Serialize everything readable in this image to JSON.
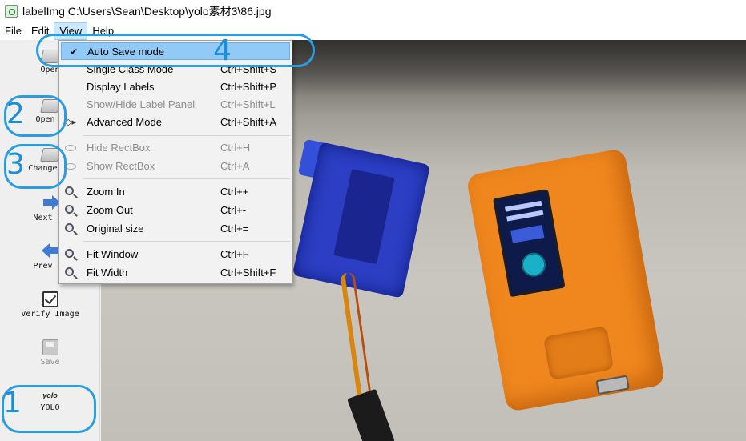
{
  "window": {
    "title": "labelImg C:\\Users\\Sean\\Desktop\\yolo素材3\\86.jpg",
    "icon": "labelimg-app-icon"
  },
  "menubar": {
    "items": [
      {
        "label": "File"
      },
      {
        "label": "Edit"
      },
      {
        "label": "View"
      },
      {
        "label": "Help"
      }
    ]
  },
  "toolbar": {
    "items": [
      {
        "label": "Open",
        "icon": "folder-icon"
      },
      {
        "label": "Open D",
        "icon": "folder-icon"
      },
      {
        "label": "Change Sa",
        "icon": "folder-icon"
      },
      {
        "label": "Next Im",
        "icon": "arrow-right-icon"
      },
      {
        "label": "Prev Im",
        "icon": "arrow-left-icon"
      },
      {
        "label": "Verify Image",
        "icon": "check-box-icon"
      },
      {
        "label": "Save",
        "icon": "save-icon",
        "disabled": true
      },
      {
        "label": "YOLO",
        "icon": "yolo-icon",
        "icon_text": "yolo"
      }
    ]
  },
  "view_menu": {
    "items": [
      {
        "label": "Auto Save mode",
        "shortcut": "",
        "checked": true,
        "highlighted": true
      },
      {
        "label": "Single Class Mode",
        "shortcut": "Ctrl+Shift+S"
      },
      {
        "label": "Display Labels",
        "shortcut": "Ctrl+Shift+P"
      },
      {
        "label": "Show/Hide Label Panel",
        "shortcut": "Ctrl+Shift+L",
        "disabled": true
      },
      {
        "label": "Advanced Mode",
        "shortcut": "Ctrl+Shift+A",
        "icon": "advanced-mode-icon"
      },
      {
        "label": "Hide RectBox",
        "shortcut": "Ctrl+H",
        "disabled": true,
        "icon": "eye-icon"
      },
      {
        "label": "Show RectBox",
        "shortcut": "Ctrl+A",
        "disabled": true,
        "icon": "eye-icon"
      },
      {
        "label": "Zoom In",
        "shortcut": "Ctrl++",
        "icon": "zoom-in-icon"
      },
      {
        "label": "Zoom Out",
        "shortcut": "Ctrl+-",
        "icon": "zoom-out-icon"
      },
      {
        "label": "Original size",
        "shortcut": "Ctrl+=",
        "icon": "zoom-original-icon"
      },
      {
        "label": "Fit Window",
        "shortcut": "Ctrl+F",
        "icon": "fit-window-icon"
      },
      {
        "label": "Fit Width",
        "shortcut": "Ctrl+Shift+F",
        "icon": "fit-width-icon"
      }
    ]
  },
  "annotations": {
    "labels": [
      "1",
      "2",
      "3",
      "4"
    ],
    "color": "#2a9de0"
  },
  "colors": {
    "menu_highlight": "#91c9f7",
    "active_menu": "#cce8ff"
  }
}
